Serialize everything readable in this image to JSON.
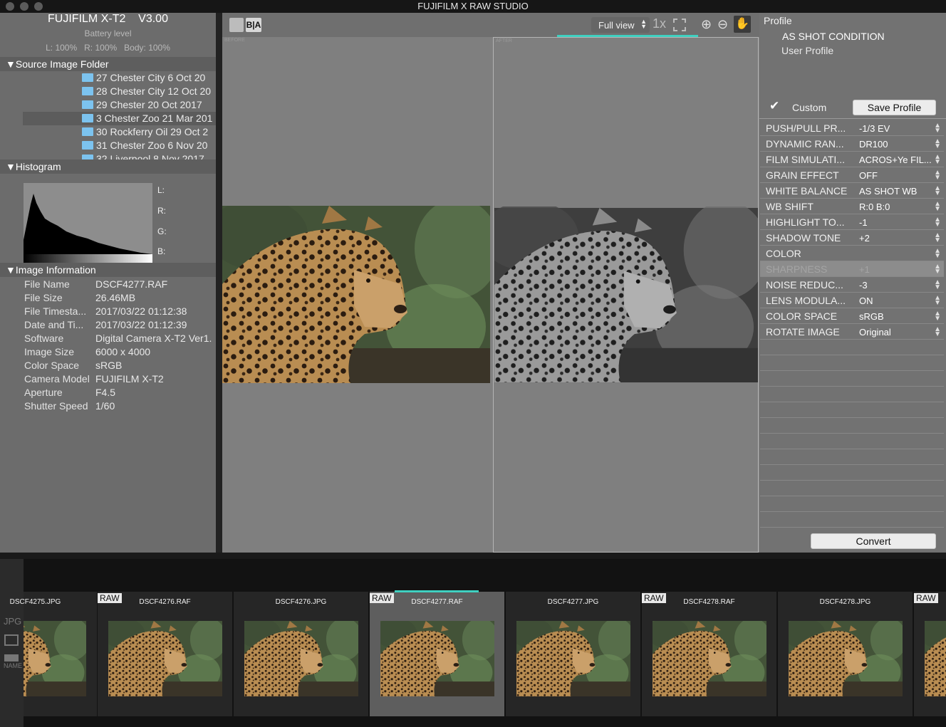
{
  "window": {
    "title": "FUJIFILM X RAW STUDIO"
  },
  "camera": {
    "model": "FUJIFILM X-T2",
    "version": "V3.00",
    "battery_label": "Battery level",
    "battery_values": "L: 100%   R: 100%   Body: 100%"
  },
  "sections": {
    "source": "▼Source Image Folder",
    "histogram": "▼Histogram",
    "info": "▼Image Information"
  },
  "folders": [
    "27 Chester City 6 Oct 20",
    "28 Chester City 12 Oct 20",
    "29 Chester 20 Oct 2017",
    "3 Chester Zoo 21 Mar 201",
    "30 Rockferry Oil 29 Oct 2",
    "31 Chester Zoo 6 Nov 20",
    "32 Liverpool 8 Nov 2017"
  ],
  "histogram_labels": [
    "L:",
    "R:",
    "G:",
    "B:"
  ],
  "image_info": [
    {
      "key": "File Name",
      "value": "DSCF4277.RAF"
    },
    {
      "key": "File Size",
      "value": "26.46MB"
    },
    {
      "key": "File Timesta...",
      "value": "2017/03/22 01:12:38"
    },
    {
      "key": "Date and Ti...",
      "value": "2017/03/22 01:12:39"
    },
    {
      "key": "Software",
      "value": "Digital Camera X-T2 Ver1."
    },
    {
      "key": "Image Size",
      "value": "6000 x 4000"
    },
    {
      "key": "Color Space",
      "value": "sRGB"
    },
    {
      "key": "Camera Model",
      "value": "FUJIFILM X-T2"
    },
    {
      "key": "Aperture",
      "value": "F4.5"
    },
    {
      "key": "Shutter Speed",
      "value": "1/60"
    }
  ],
  "toolbar": {
    "view_select": "Full view",
    "ba_label": "B|A",
    "zoom_label": "1x"
  },
  "compare": {
    "before": "BEFORE",
    "after": "AFTER"
  },
  "profile": {
    "title": "Profile",
    "as_shot": "AS SHOT CONDITION",
    "user_profile": "User Profile",
    "custom": "Custom",
    "save_label": "Save Profile",
    "convert_label": "Convert"
  },
  "settings": [
    {
      "key": "PUSH/PULL PR...",
      "value": "-1/3 EV"
    },
    {
      "key": "DYNAMIC RAN...",
      "value": "DR100"
    },
    {
      "key": "FILM SIMULATI...",
      "value": "ACROS+Ye FIL..."
    },
    {
      "key": "GRAIN EFFECT",
      "value": "OFF"
    },
    {
      "key": "WHITE BALANCE",
      "value": "AS SHOT WB"
    },
    {
      "key": "WB SHIFT",
      "value": "R:0 B:0"
    },
    {
      "key": "HIGHLIGHT TO...",
      "value": "-1"
    },
    {
      "key": "SHADOW TONE",
      "value": "+2"
    },
    {
      "key": "COLOR",
      "value": ""
    },
    {
      "key": "SHARPNESS",
      "value": "+1"
    },
    {
      "key": "NOISE REDUC...",
      "value": "-3"
    },
    {
      "key": "LENS MODULA...",
      "value": "ON"
    },
    {
      "key": "COLOR SPACE",
      "value": "sRGB"
    },
    {
      "key": "ROTATE IMAGE",
      "value": "Original"
    }
  ],
  "strip": {
    "side_labels": [
      "JPG",
      "NAME"
    ],
    "thumbs": [
      {
        "name": "DSCF4275.JPG",
        "raw": ""
      },
      {
        "name": "DSCF4276.RAF",
        "raw": "RAW"
      },
      {
        "name": "DSCF4276.JPG",
        "raw": ""
      },
      {
        "name": "DSCF4277.RAF",
        "raw": "RAW"
      },
      {
        "name": "DSCF4277.JPG",
        "raw": ""
      },
      {
        "name": "DSCF4278.RAF",
        "raw": "RAW"
      },
      {
        "name": "DSCF4278.JPG",
        "raw": ""
      },
      {
        "name": "",
        "raw": "RAW"
      }
    ]
  },
  "colors": {
    "accent": "#3fd0c0",
    "panel": "#6c6c6c",
    "strip": "#121212"
  }
}
